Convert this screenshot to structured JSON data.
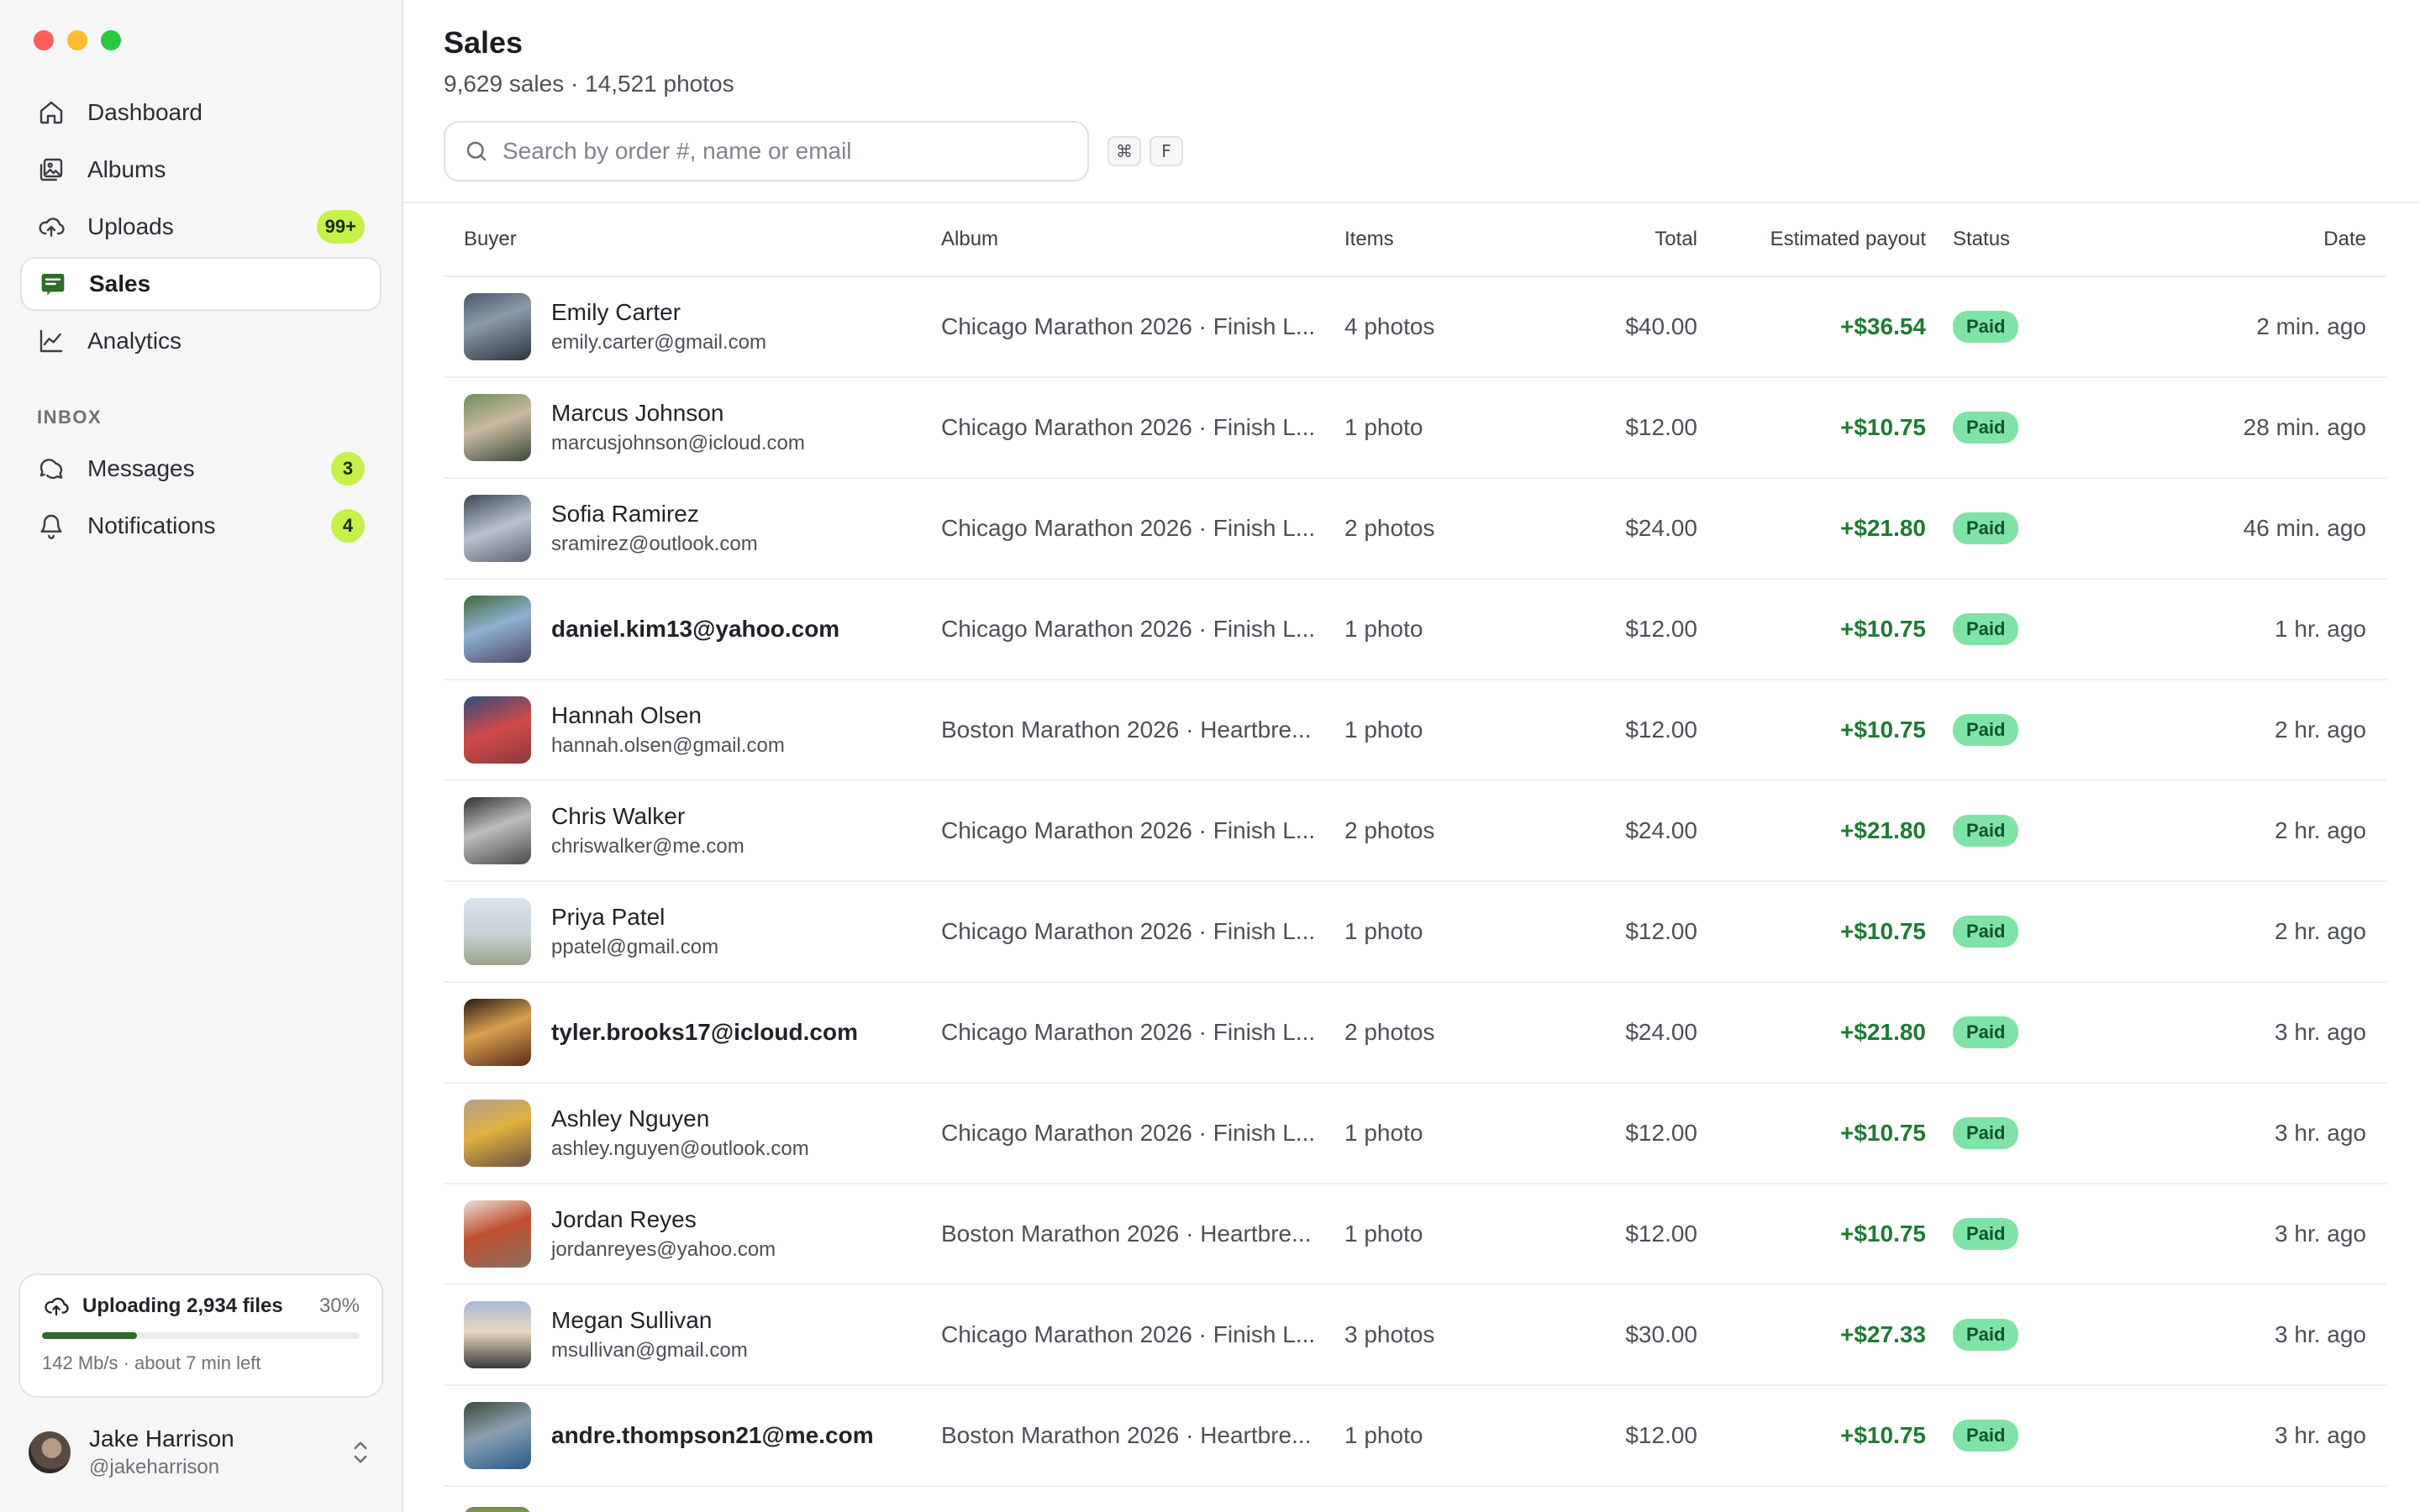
{
  "window": {
    "traffic_lights": [
      "close",
      "minimize",
      "zoom"
    ]
  },
  "sidebar": {
    "nav": [
      {
        "label": "Dashboard",
        "icon": "home-icon",
        "badge": null,
        "active": false
      },
      {
        "label": "Albums",
        "icon": "image-icon",
        "badge": null,
        "active": false
      },
      {
        "label": "Uploads",
        "icon": "cloud-upload-icon",
        "badge": "99+",
        "active": false
      },
      {
        "label": "Sales",
        "icon": "receipt-icon",
        "badge": null,
        "active": true
      },
      {
        "label": "Analytics",
        "icon": "chart-line-icon",
        "badge": null,
        "active": false
      }
    ],
    "inbox_label": "INBOX",
    "inbox": [
      {
        "label": "Messages",
        "icon": "chat-bubbles-icon",
        "badge": "3"
      },
      {
        "label": "Notifications",
        "icon": "bell-icon",
        "badge": "4"
      }
    ],
    "upload": {
      "title": "Uploading 2,934 files",
      "percent_label": "30%",
      "progress": 0.3,
      "subtitle": "142 Mb/s · about 7 min left"
    },
    "profile": {
      "name": "Jake Harrison",
      "handle": "@jakeharrison"
    }
  },
  "header": {
    "title": "Sales",
    "subtitle": "9,629 sales · 14,521 photos",
    "search_placeholder": "Search by order #, name or email",
    "shortcut_keys": [
      "⌘",
      "F"
    ]
  },
  "table": {
    "columns": {
      "buyer": "Buyer",
      "album": "Album",
      "items": "Items",
      "total": "Total",
      "payout": "Estimated payout",
      "status": "Status",
      "date": "Date"
    },
    "rows": [
      {
        "name": "Emily Carter",
        "email": "emily.carter@gmail.com",
        "album": "Chicago Marathon 2026 · Finish L...",
        "items": "4 photos",
        "total": "$40.00",
        "payout": "+$36.54",
        "status": "Paid",
        "date": "2 min. ago"
      },
      {
        "name": "Marcus Johnson",
        "email": "marcusjohnson@icloud.com",
        "album": "Chicago Marathon 2026 · Finish L...",
        "items": "1 photo",
        "total": "$12.00",
        "payout": "+$10.75",
        "status": "Paid",
        "date": "28 min. ago"
      },
      {
        "name": "Sofia Ramirez",
        "email": "sramirez@outlook.com",
        "album": "Chicago Marathon 2026 · Finish L...",
        "items": "2 photos",
        "total": "$24.00",
        "payout": "+$21.80",
        "status": "Paid",
        "date": "46 min. ago"
      },
      {
        "name": "",
        "email": "daniel.kim13@yahoo.com",
        "album": "Chicago Marathon 2026 · Finish L...",
        "items": "1 photo",
        "total": "$12.00",
        "payout": "+$10.75",
        "status": "Paid",
        "date": "1 hr. ago"
      },
      {
        "name": "Hannah Olsen",
        "email": "hannah.olsen@gmail.com",
        "album": "Boston Marathon 2026 · Heartbre...",
        "items": "1 photo",
        "total": "$12.00",
        "payout": "+$10.75",
        "status": "Paid",
        "date": "2 hr. ago"
      },
      {
        "name": "Chris Walker",
        "email": "chriswalker@me.com",
        "album": "Chicago Marathon 2026 · Finish L...",
        "items": "2 photos",
        "total": "$24.00",
        "payout": "+$21.80",
        "status": "Paid",
        "date": "2 hr. ago"
      },
      {
        "name": "Priya Patel",
        "email": "ppatel@gmail.com",
        "album": "Chicago Marathon 2026 · Finish L...",
        "items": "1 photo",
        "total": "$12.00",
        "payout": "+$10.75",
        "status": "Paid",
        "date": "2 hr. ago"
      },
      {
        "name": "",
        "email": "tyler.brooks17@icloud.com",
        "album": "Chicago Marathon 2026 · Finish L...",
        "items": "2 photos",
        "total": "$24.00",
        "payout": "+$21.80",
        "status": "Paid",
        "date": "3 hr. ago"
      },
      {
        "name": "Ashley Nguyen",
        "email": "ashley.nguyen@outlook.com",
        "album": "Chicago Marathon 2026 · Finish L...",
        "items": "1 photo",
        "total": "$12.00",
        "payout": "+$10.75",
        "status": "Paid",
        "date": "3 hr. ago"
      },
      {
        "name": "Jordan Reyes",
        "email": "jordanreyes@yahoo.com",
        "album": "Boston Marathon 2026 · Heartbre...",
        "items": "1 photo",
        "total": "$12.00",
        "payout": "+$10.75",
        "status": "Paid",
        "date": "3 hr. ago"
      },
      {
        "name": "Megan Sullivan",
        "email": "msullivan@gmail.com",
        "album": "Chicago Marathon 2026 · Finish L...",
        "items": "3 photos",
        "total": "$30.00",
        "payout": "+$27.33",
        "status": "Paid",
        "date": "3 hr. ago"
      },
      {
        "name": "",
        "email": "andre.thompson21@me.com",
        "album": "Boston Marathon 2026 · Heartbre...",
        "items": "1 photo",
        "total": "$12.00",
        "payout": "+$10.75",
        "status": "Paid",
        "date": "3 hr. ago"
      }
    ]
  },
  "colors": {
    "accent_green": "#c6f04a",
    "payout_green": "#1f7a34",
    "paid_pill": "#7fe3a6",
    "progress_fill": "#2f6b2a",
    "active_sales_icon": "#2f6b2a"
  }
}
